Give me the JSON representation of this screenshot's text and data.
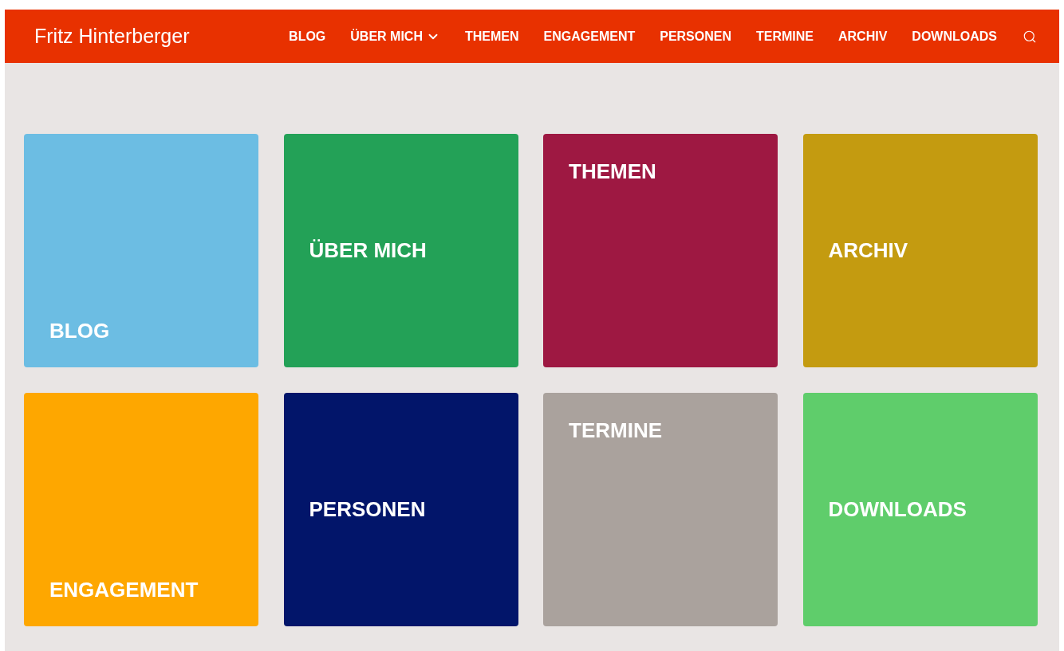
{
  "header": {
    "site_title": "Fritz Hinterberger",
    "nav": [
      {
        "label": "BLOG",
        "has_submenu": false
      },
      {
        "label": "ÜBER MICH",
        "has_submenu": true
      },
      {
        "label": "THEMEN",
        "has_submenu": false
      },
      {
        "label": "ENGAGEMENT",
        "has_submenu": false
      },
      {
        "label": "PERSONEN",
        "has_submenu": false
      },
      {
        "label": "TERMINE",
        "has_submenu": false
      },
      {
        "label": "ARCHIV",
        "has_submenu": false
      },
      {
        "label": "DOWNLOADS",
        "has_submenu": false
      }
    ]
  },
  "tiles": [
    {
      "label": "BLOG",
      "color": "#6cbde3",
      "kind": "bottom"
    },
    {
      "label": "ÜBER MICH",
      "color": "#23a157",
      "kind": "middle"
    },
    {
      "label": "THEMEN",
      "color": "#9e1842",
      "kind": "top"
    },
    {
      "label": "ARCHIV",
      "color": "#c49b10",
      "kind": "middle"
    },
    {
      "label": "ENGAGEMENT",
      "color": "#fea700",
      "kind": "bottom"
    },
    {
      "label": "PERSONEN",
      "color": "#02156a",
      "kind": "middle"
    },
    {
      "label": "TERMINE",
      "color": "#aaa29d",
      "kind": "top"
    },
    {
      "label": "DOWNLOADS",
      "color": "#5fcd6b",
      "kind": "middle"
    }
  ]
}
